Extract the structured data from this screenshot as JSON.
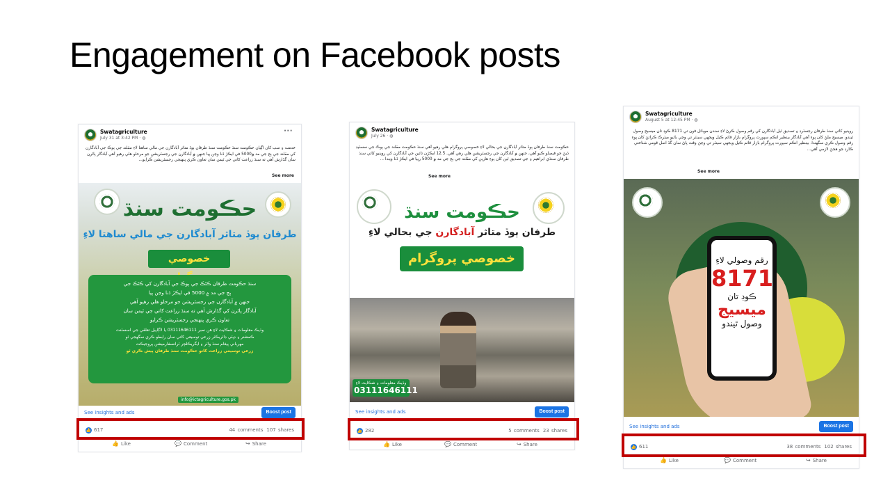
{
  "slide": {
    "title": "Engagement on Facebook posts"
  },
  "posts": [
    {
      "page_name": "Swatagriculture",
      "date": "July 31 at 3:42 PM · ",
      "caption": "خدمت ۽ سب کان اڳيان حڪومت سنڌ حڪومت سنڌ طرفان ٻوڏ متاثر آبادگارن جي مالي ساهتا لاءِ مقلند جي ٻوڪ جي آبادگارن کي مقلند جي ٻج جي مد ۾5000 في ايڪڙ ڏنا وڃن پيا جنهن ۾ آبادگارن جي رجسٽريشن جو مرحلو هلي رهيو آهي آبادگار پاڻرن سان گڏارش آهي ته سنڌ زراعت کاتي جي ٽيمن سان تعاون ڪري پنهنجي رجسٽريشن ڪرايو...",
      "see_more": "See more",
      "image": {
        "headline": "حڪومت سنڌ",
        "subline": "طرفان ٻوڏ متاثر آبادگارن جي مالي ساهتا لاءِ",
        "program": "خصوصي پروگرام",
        "box_lines": [
          "سنڌ حڪومت طرفان ڪڻڪ جي ٻوڪ جي آبادگارن کي ڪڻڪ جي",
          "ٻج جي مد ۾ 5000 في ايڪڙ ڏنا وڃن پيا",
          "جنهن ۾ آبادگارن جي رجسٽريشن جو مرحلو هلي رهيو آهي",
          "آبادگار پاڻرن کي گڏارش آهي ته سنڌ زراعت کاتي جي ٽيمن سان",
          "تعاون ڪري پنهنجي رجسٽريشن ڪرايو",
          "وڌيڪ معلومات ۽ شڪايت لاءِ هن نمبر 03111646111 يا لاڳاپيل تعلقي جي اسسٽنٽ",
          "ڪمشنر ۽ ڊپٽي ڊائريڪٽر زرعي توسيعي کاتي سان رابطو ڪري سگهجي ٿو",
          "مهرباني پيغام سنڌ واٽر ۽ ايگريڪلچر ٽرانسفارميشن پروجيڪٽ",
          "زرعي توسيعي زراعت کاتو حڪومت سنڌ طرفان پيش ڪري ٿو"
        ],
        "email": "info@ictagriculture.gos.pk"
      },
      "insights_link": "See insights and ads",
      "boost_label": "Boost post",
      "reactions": "617",
      "comments": "44 comments",
      "shares": "107 shares",
      "like_label": "Like",
      "comment_label": "Comment",
      "share_label": "Share"
    },
    {
      "page_name": "Swatagriculture",
      "date": "July 26 · ",
      "caption": "حڪومت سنڌ طرفان ٻوڏ متاثر آبادگارن جي بحالي لاءِ خصوصي پروگرام هلي رهيو آهي سنڌ حڪومت مقلند جي ٻوڪ جي سسٽيڊ ڏيڻ جو فيصلو ڪيو آهي، جنهن ۾ آبادگارن جي رجسٽريشن هلي رهي آهي. 12.5 ايڪڙن تائين جي آبادگارن کي روينيو کاتي سنڌ طرفان سنڌي ابراهيم ۽ جي تصديق ٿين کان پوءِ هارين کي مقلند جي ٻج جي مد ۾ 5000 رپيا في ايڪڙ ڏنا ويندا ...",
      "see_more": "See more",
      "image": {
        "headline": "حڪومت سنڌ",
        "subline_a": "طرفان ٻوڏ متاثر",
        "subline_b": "آبادگارن",
        "subline_c": "جي بحالي لاءِ",
        "program": "خصوصي پروگرام",
        "hotline_label": "وڌيڪ معلومات ۽ شڪايت لاءِ",
        "hotline_number": "03111646111"
      },
      "insights_link": "See insights and ads",
      "boost_label": "Boost post",
      "reactions": "282",
      "comments": "5 comments",
      "shares": "23 shares",
      "like_label": "Like",
      "comment_label": "Comment",
      "share_label": "Share"
    },
    {
      "page_name": "Swatagriculture",
      "date": "August 5 at 12:45 PM · ",
      "caption": "روينيو کاتي سنڌ طرفان رجسٽرڊ ۽ تصديق ٿيل آبادگارن کي رقم وصول ڪرڻ لاءِ سندن موبائل فون تي 8171 ڪوڊ تان ميسيج وصول ٿيندو. ميسيج ملڻ کان پوءِ آهي آبادگار بينظير انڪم سپورٽ پروگرام بازار قائم ڪيل ويجهي سينٽر تي وڃي بائيو ميٽرڪ ڪرائڻ کان پوءِ رقم وصول ڪري سگهندا. بينظير انڪم سپورٽ پروگرام بازار قائم ڪيل ويجهي سينٽر تي وڃڻ وقت پاڻ سان گڏ اصل قومي شناختي ڪارڊ جو هجڻ لازمي آهي...",
      "see_more": "See more",
      "image": {
        "line1": "رقم وصولي لاءِ",
        "code": "8171",
        "line2": "ڪوڊ تان",
        "line3": "ميسيج",
        "line4": "وصول ٿيندو"
      },
      "insights_link": "See insights and ads",
      "boost_label": "Boost post",
      "reactions": "611",
      "comments": "38 comments",
      "shares": "102 shares",
      "like_label": "Like",
      "comment_label": "Comment",
      "share_label": "Share"
    }
  ],
  "colors": {
    "highlight": "#c00000",
    "facebook_blue": "#1b74e4",
    "program_green": "#1a8e3c",
    "program_yellow": "#ffe23c",
    "code_red": "#d81e1e"
  },
  "icons": [
    "more-menu-icon",
    "globe-icon",
    "like-reaction-icon",
    "thumbs-up-icon",
    "comment-icon",
    "share-icon"
  ]
}
